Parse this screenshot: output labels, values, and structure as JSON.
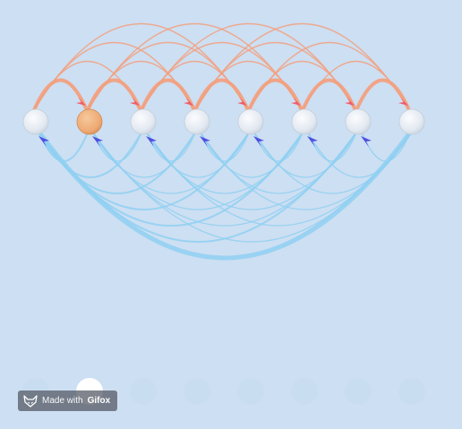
{
  "diagram": {
    "node_count": 8,
    "highlighted_node": 1,
    "forward_arc_span_max": 4,
    "backward_arc_span_max": 7,
    "colors": {
      "background": "#cddff2",
      "node_fill": "#e9eef5",
      "node_highlight": "#f0b07a",
      "forward_arc": "#f2a07f",
      "forward_arrow": "#f05a6a",
      "backward_arc": "#8fd0f2",
      "backward_arrow": "#4f4fe0",
      "progress_dot": "#ffffff",
      "progress_dot_faded": "#c6daf0"
    }
  },
  "progress": {
    "count": 8,
    "active": 1
  },
  "watermark": {
    "prefix": "Made with",
    "brand": "Gifox",
    "icon": "fox-icon"
  }
}
